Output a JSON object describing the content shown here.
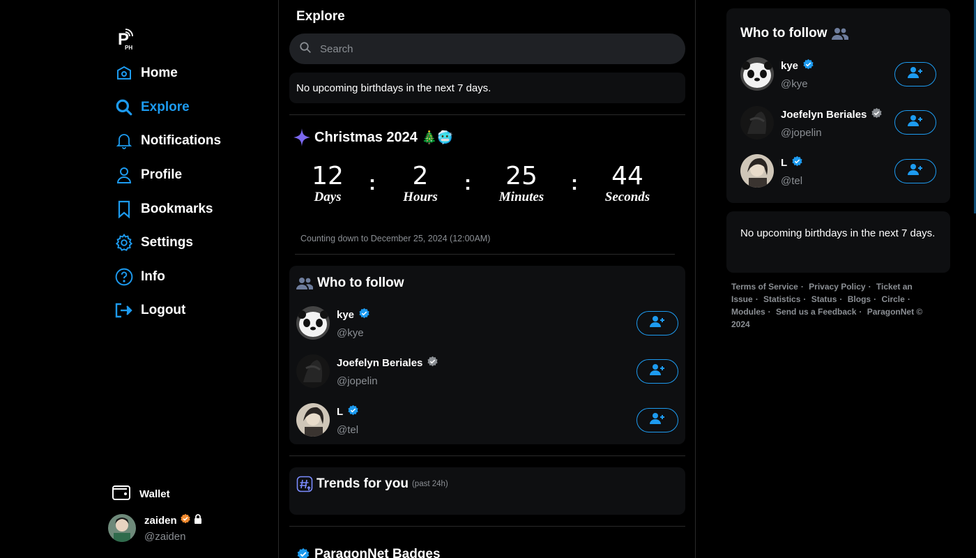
{
  "sidebar": {
    "logo": "PPH",
    "nav": [
      {
        "label": "Home",
        "icon": "home-icon"
      },
      {
        "label": "Explore",
        "icon": "search-icon",
        "active": true
      },
      {
        "label": "Notifications",
        "icon": "bell-icon"
      },
      {
        "label": "Profile",
        "icon": "user-icon"
      },
      {
        "label": "Bookmarks",
        "icon": "bookmark-icon"
      },
      {
        "label": "Settings",
        "icon": "gear-icon"
      },
      {
        "label": "Info",
        "icon": "question-icon"
      },
      {
        "label": "Logout",
        "icon": "logout-icon"
      }
    ],
    "wallet_label": "Wallet",
    "current_user": {
      "name": "zaiden",
      "handle": "@zaiden"
    }
  },
  "main": {
    "title": "Explore",
    "search_placeholder": "Search",
    "birthday_text": "No upcoming birthdays in the next 7 days.",
    "countdown": {
      "title": "Christmas 2024",
      "title_emoji": "🎄🥶",
      "days": "12",
      "days_label": "Days",
      "hours": "2",
      "hours_label": "Hours",
      "minutes": "25",
      "minutes_label": "Minutes",
      "seconds": "44",
      "seconds_label": "Seconds",
      "separator": ":",
      "note": "Counting down to December 25, 2024 (12:00AM)"
    },
    "who_to_follow": {
      "title": "Who to follow",
      "users": [
        {
          "name": "kye",
          "handle": "@kye",
          "badge_color": "#1d9bf0"
        },
        {
          "name": "Joefelyn Beriales",
          "handle": "@jopelin",
          "badge_color": "#8b8f94"
        },
        {
          "name": "L",
          "handle": "@tel",
          "badge_color": "#1d9bf0"
        }
      ]
    },
    "trends": {
      "title": "Trends for you",
      "subtitle": "(past 24h)"
    },
    "badges_title": "ParagonNet Badges"
  },
  "right": {
    "who_to_follow_title": "Who to follow",
    "birthday_text": "No upcoming birthdays in the next 7 days.",
    "footer_links": [
      "Terms of Service",
      "Privacy Policy",
      "Ticket an Issue",
      "Statistics",
      "Status",
      "Blogs",
      "Circle",
      "Modules",
      "Send us a Feedback"
    ],
    "copyright": "ParagonNet © 2024"
  },
  "colors": {
    "accent": "#1d9bf0",
    "card": "#0e0f11",
    "muted": "#8b8f94",
    "owner_badge": "#f28b30",
    "sparkle": "#7b68ee"
  }
}
